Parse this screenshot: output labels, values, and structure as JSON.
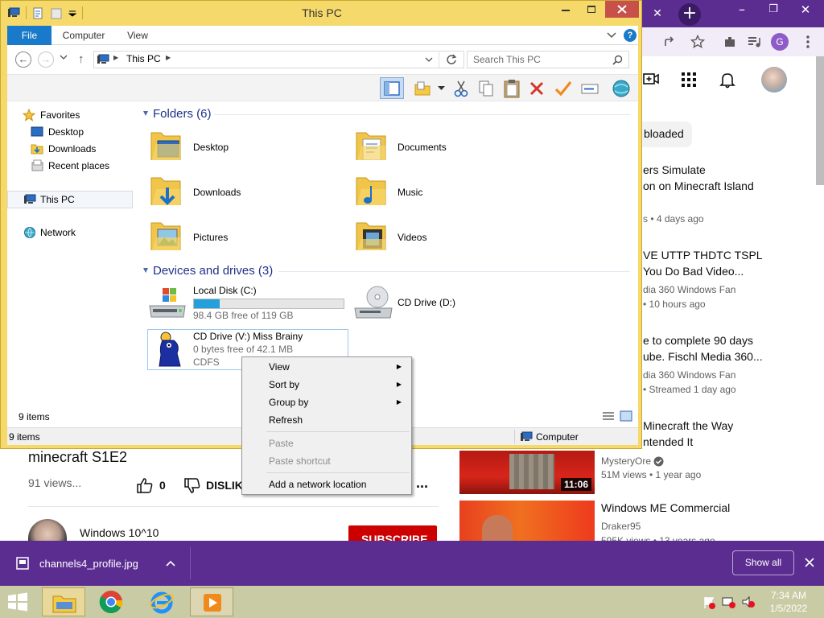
{
  "browser": {
    "top_bar": {
      "close_tab": "✕",
      "new_tab": "+",
      "restore": "❐",
      "minimize": "–",
      "close": "✕"
    },
    "toolbar_avatar_letter": "G",
    "yt_header": {
      "chip_label": "bloaded"
    },
    "video_list": [
      {
        "title1": "ers Simulate",
        "title2": "on on Minecraft Island",
        "meta1": "",
        "meta2": "s • 4 days ago"
      },
      {
        "title1": "VE UTTP THDTC TSPL",
        "title2": "You Do Bad Video...",
        "meta1": "dia 360 Windows Fan",
        "meta2": "• 10 hours ago"
      },
      {
        "title1": "e to complete 90 days",
        "title2": "ube. Fischl Media 360...",
        "meta1": "dia 360 Windows Fan",
        "meta2": "• Streamed 1 day ago"
      },
      {
        "title1": "Minecraft the Way",
        "title2": "ntended It",
        "meta1": "",
        "meta2": ""
      },
      {
        "channel": "MysteryOre",
        "meta": "51M views • 1 year ago",
        "duration": "11:06"
      },
      {
        "title1": "Windows ME Commercial",
        "channel": "Draker95",
        "meta": "595K views • 13 years ago"
      }
    ],
    "main_video": {
      "title": "minecraft S1E2",
      "views": "91 views...",
      "likes": "0",
      "dislike_label": "DISLIK",
      "more": "...",
      "channel_name": "Windows 10^10",
      "subscribe": "SUBSCRIBE"
    },
    "download_bar": {
      "file": "channels4_profile.jpg",
      "show_all": "Show all",
      "chevron": "^",
      "close": "✕"
    }
  },
  "explorer": {
    "title": "This PC",
    "tabs": [
      "File",
      "Computer",
      "View"
    ],
    "address": {
      "root": "This PC",
      "search_placeholder": "Search This PC"
    },
    "nav_pane": {
      "favorites": "Favorites",
      "desktop": "Desktop",
      "downloads": "Downloads",
      "recent": "Recent places",
      "this_pc": "This PC",
      "network": "Network"
    },
    "folders_header": "Folders (6)",
    "folders": [
      "Desktop",
      "Documents",
      "Downloads",
      "Music",
      "Pictures",
      "Videos"
    ],
    "drives_header": "Devices and drives (3)",
    "drives": [
      {
        "name": "Local Disk (C:)",
        "free": "98.4 GB free of 119 GB",
        "used_fraction": 0.17
      },
      {
        "name": "CD Drive (D:)"
      },
      {
        "name": "CD Drive (V:) Miss Brainy",
        "free": "0 bytes free of 42.1 MB",
        "fs": "CDFS"
      }
    ],
    "item_count": "9 items",
    "status": {
      "left": "9 items",
      "right": "Computer"
    }
  },
  "context_menu": {
    "view": "View",
    "sort_by": "Sort by",
    "group_by": "Group by",
    "refresh": "Refresh",
    "paste": "Paste",
    "paste_shortcut": "Paste shortcut",
    "add_network": "Add a network location"
  },
  "taskbar": {
    "time": "7:34 AM",
    "date": "1/5/2022"
  },
  "colors": {
    "window_frame": "#f5d96b",
    "file_tab": "#1979ca",
    "browser_purple": "#5c2d91",
    "subscribe_red": "#cc0000"
  }
}
